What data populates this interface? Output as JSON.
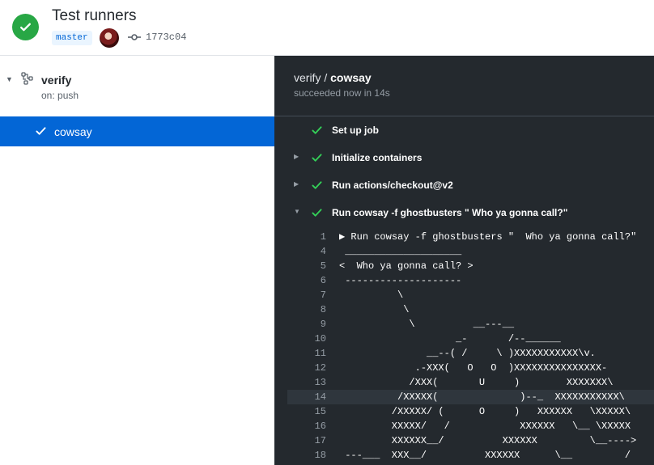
{
  "header": {
    "title": "Test runners",
    "branch": "master",
    "commit_sha": "1773c04",
    "status_color": "#28a745"
  },
  "sidebar": {
    "workflow_name": "verify",
    "trigger": "on: push",
    "job": {
      "label": "cowsay",
      "selected_color": "#0366d6"
    }
  },
  "log": {
    "workflow": "verify",
    "separator": " / ",
    "job": "cowsay",
    "status": "succeeded now in 14s",
    "steps": [
      {
        "label": "Set up job",
        "expandable": false
      },
      {
        "label": "Initialize containers",
        "expandable": true
      },
      {
        "label": "Run actions/checkout@v2",
        "expandable": true
      },
      {
        "label": "Run cowsay -f ghostbusters \" Who ya gonna call?\"",
        "expandable": true,
        "expanded": true
      }
    ],
    "lines": [
      {
        "n": "1",
        "text": "▶ Run cowsay -f ghostbusters \"  Who ya gonna call?\""
      },
      {
        "n": "4",
        "text": " ____________________"
      },
      {
        "n": "5",
        "text": "<  Who ya gonna call? >"
      },
      {
        "n": "6",
        "text": " --------------------"
      },
      {
        "n": "7",
        "text": "          \\"
      },
      {
        "n": "8",
        "text": "           \\"
      },
      {
        "n": "9",
        "text": "            \\          __---__"
      },
      {
        "n": "10",
        "text": "                    _-       /--______"
      },
      {
        "n": "11",
        "text": "               __--( /     \\ )XXXXXXXXXXX\\v."
      },
      {
        "n": "12",
        "text": "             .-XXX(   O   O  )XXXXXXXXXXXXXXX-"
      },
      {
        "n": "13",
        "text": "            /XXX(       U     )        XXXXXXX\\"
      },
      {
        "n": "14",
        "text": "          /XXXXX(              )--_  XXXXXXXXXXX\\"
      },
      {
        "n": "15",
        "text": "         /XXXXX/ (      O     )   XXXXXX   \\XXXXX\\"
      },
      {
        "n": "16",
        "text": "         XXXXX/   /            XXXXXX   \\__ \\XXXXX"
      },
      {
        "n": "17",
        "text": "         XXXXXX__/          XXXXXX         \\__---->"
      },
      {
        "n": "18",
        "text": " ---___  XXX__/          XXXXXX      \\__         /"
      }
    ],
    "highlighted_line": "14",
    "check_color": "#34d058"
  }
}
